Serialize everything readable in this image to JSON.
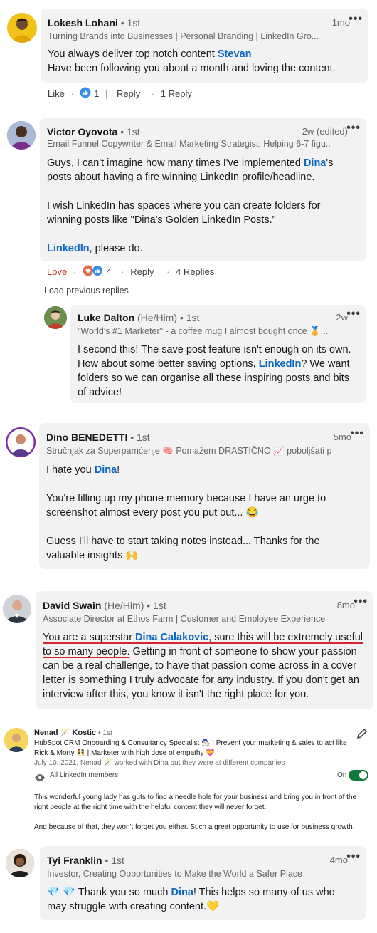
{
  "comments": [
    {
      "name": "Lokesh Lohani",
      "degree": "• 1st",
      "time": "1mo",
      "headline": "Turning Brands into Businesses | Personal Branding | LinkedIn Gro...",
      "body_1_before": "You always deliver top notch content ",
      "body_1_mention": "Stevan",
      "body_2": "Have been following you about a month and loving the content.",
      "like_label": "Like",
      "reaction_count": "1",
      "reply_label": "Reply",
      "replies_label": "1 Reply"
    },
    {
      "name": "Victor Oyovota",
      "degree": "• 1st",
      "time": "2w (edited)",
      "headline": "Email Funnel Copywriter & Email Marketing Strategist: Helping 6-7 figu...",
      "p1_before": "Guys, I can't imagine how many times I've implemented ",
      "p1_mention": "Dina",
      "p1_after": "'s posts about having a fire winning LinkedIn profile/headline.",
      "p2": "I wish LinkedIn has spaces where you can create folders for winning posts like \"Dina's Golden LinkedIn Posts.\"",
      "p3_mention": "LinkedIn",
      "p3_after": ", please do.",
      "like_label": "Love",
      "reaction_count": "4",
      "reply_label": "Reply",
      "replies_label": "4 Replies"
    },
    {
      "load_previous": "Load previous replies"
    },
    {
      "name": "Luke Dalton",
      "pronouns": "(He/Him)",
      "degree": "• 1st",
      "time": "2w",
      "headline": "\"World's #1 Marketer\" - a coffee mug I almost bought once 🏅...",
      "p1_before": "I second this! The save post feature isn't enough on its own. How about some better saving options, ",
      "p1_mention": "LinkedIn",
      "p1_after": "? We want folders so we can organise all these inspiring posts and bits of advice!"
    },
    {
      "name": "Dino BENEDETTI",
      "degree": "• 1st",
      "time": "5mo",
      "headline": "Stručnjak za Superpamćenje 🧠 Pomažem DRASTIČNO 📈 poboljšati p...",
      "p1_before": "I hate you ",
      "p1_mention": "Dina",
      "p1_after": "!",
      "p2": "You're filling up my phone memory because I have an urge to screenshot almost every post you put out... 😂",
      "p3": "Guess I'll have to start taking notes instead... Thanks for the valuable insights 🙌"
    },
    {
      "name": "David Swain",
      "pronouns": "(He/Him)",
      "degree": "• 1st",
      "time": "8mo",
      "headline": "Associate Director at Ethos Farm | Customer and Employee Experience ...",
      "u1": "You are a superstar ",
      "u_mention": "Dina Calakovic",
      "u2": ", sure this will be extremely useful to so many people.",
      "rest": " Getting in front of someone to show your passion can be a real challenge, to have that passion come across in a cover letter is something I truly advocate for any industry. If you don't get an interview after this, you know it isn't the right place for you."
    },
    {
      "name": "Nenad 🪄 Kostic",
      "degree": "• 1st",
      "headline": "HubSpot CRM Onboarding & Consultancy Specialist 🧙🏻‍♂️ | Prevent your marketing & sales to act like Rick & Morty 👯 | Marketer with high dose of empathy 💝",
      "date_line": "July 10, 2021, Nenad 🪄 worked with Dina but they were at different companies",
      "visibility": "All LinkedIn members",
      "toggle_label": "On",
      "p1": "This wonderful young lady has guts to find a needle hole for your business and bring you in front of the right people at the right time with the helpful content they will never forget.",
      "p2": "And because of that, they won't forget you either. Such a great opportunity to use for business growth."
    },
    {
      "name": "Tyi Franklin",
      "degree": "• 1st",
      "time": "4mo",
      "headline": "Investor, Creating Opportunities to Make the World a Safer Place",
      "p1_before": "💎 💎 Thank you so much ",
      "p1_mention": "Dina",
      "p1_after": "! This helps so many of us who may struggle with creating content.💛"
    }
  ],
  "menu_icon": "•••",
  "colors": {
    "bubble": "#f2f2f2",
    "link": "#0a66c2",
    "love": "#b24020",
    "toggle_on": "#0e7a3a",
    "underline": "#d0282b"
  }
}
